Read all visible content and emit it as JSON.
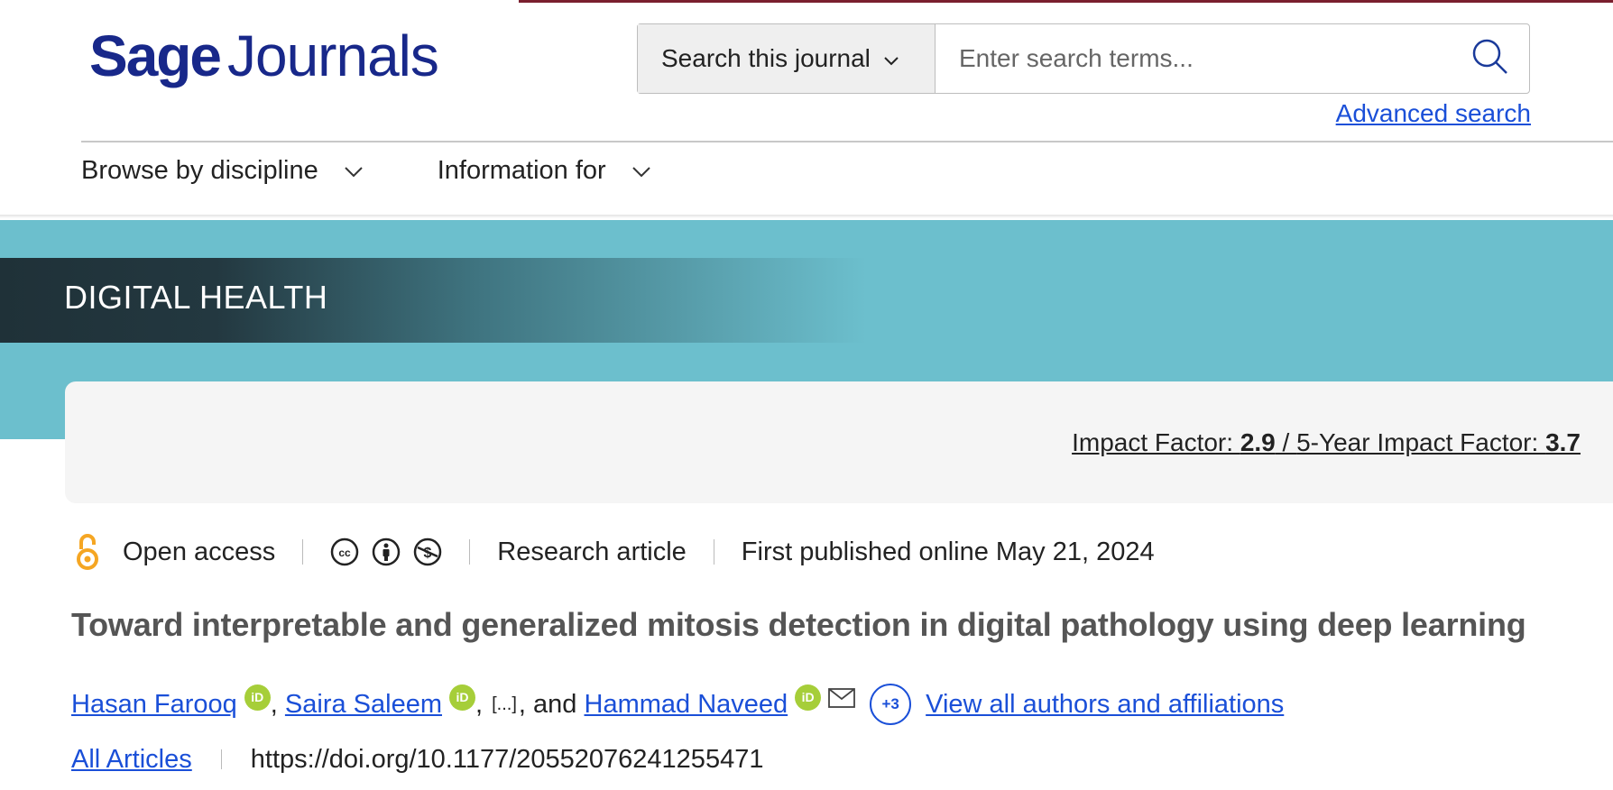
{
  "header": {
    "logo_brand": "Sage",
    "logo_product": "Journals",
    "search_scope": "Search this journal",
    "search_placeholder": "Enter search terms...",
    "advanced_search": "Advanced search"
  },
  "nav": {
    "items": [
      {
        "label": "Browse by discipline",
        "icon": "chevron-down-icon"
      },
      {
        "label": "Information for",
        "icon": "chevron-down-icon"
      }
    ]
  },
  "journal": {
    "title": "DIGITAL HEALTH",
    "impact_label": "Impact Factor: ",
    "impact_value": "2.9",
    "impact_sep": " / ",
    "five_year_label": "5-Year Impact Factor: ",
    "five_year_value": "3.7"
  },
  "article": {
    "access": "Open access",
    "license_icons": [
      "cc-icon",
      "by-icon",
      "nc-icon"
    ],
    "type": "Research article",
    "published": "First published online May 21, 2024",
    "title": "Toward interpretable and generalized mitosis detection in digital pathology using deep learning",
    "authors": [
      "Hasan Farooq",
      "Saira Saleem",
      "Hammad Naveed"
    ],
    "orcid_label": "iD",
    "ellipsis": "[...]",
    "and_text": "and",
    "more_authors": "+3",
    "view_all": "View all authors and affiliations",
    "all_articles": "All Articles",
    "doi": "https://doi.org/10.1177/20552076241255471"
  },
  "colors": {
    "brand": "#18288a",
    "link": "#1a4fd8",
    "band": "#6cbfcd",
    "orcid": "#a6ce39",
    "open_access": "#f5a623"
  }
}
